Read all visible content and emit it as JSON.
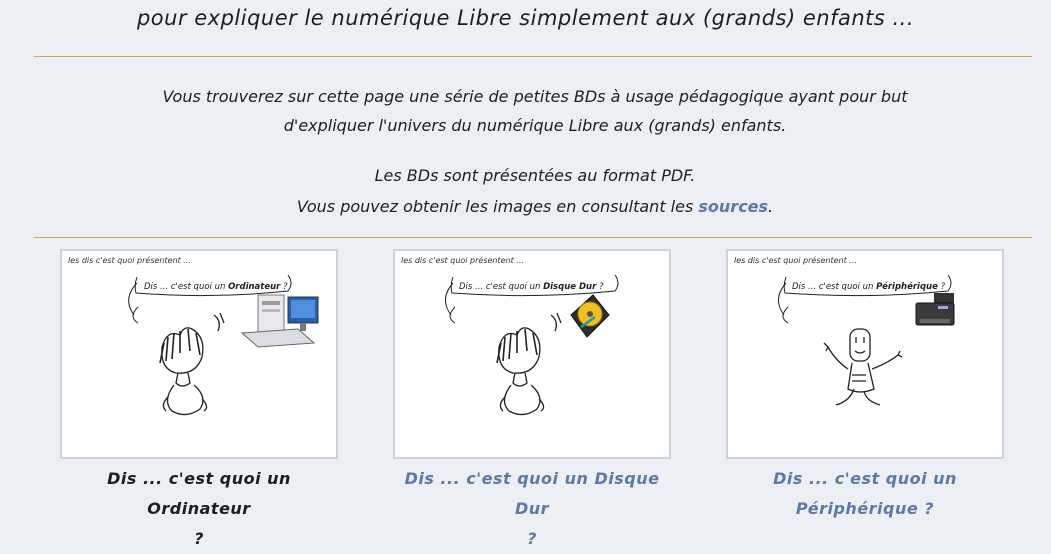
{
  "header": {
    "subtitle": "pour expliquer le numérique Libre simplement aux (grands) enfants ..."
  },
  "intro": {
    "line1": "Vous trouverez sur cette page une série de petites BDs à usage pédagogique ayant pour but",
    "line2": "d'expliquer l'univers du numérique Libre aux (grands) enfants.",
    "line3": "Les BDs sont présentées au format PDF.",
    "line4_before": "Vous pouvez obtenir les images en consultant les ",
    "line4_link": "sources",
    "line4_after": "."
  },
  "colors": {
    "background": "#ecf0f4",
    "separator": "#e2a64a",
    "link": "#5b7aa5"
  },
  "comics": [
    {
      "presenting": "les dis c'est quoi présentent ...",
      "bubble_prefix": "Dis ... c'est quoi un ",
      "bubble_object": "Ordinateur",
      "bubble_suffix": " ?",
      "caption_line1": "Dis ... c'est quoi un Ordinateur",
      "caption_line2": "?",
      "icon": "computer-icon"
    },
    {
      "presenting": "les dis c'est quoi présentent ...",
      "bubble_prefix": "Dis ... c'est quoi un ",
      "bubble_object": "Disque Dur",
      "bubble_suffix": " ?",
      "caption_line1": "Dis ... c'est quoi un Disque Dur",
      "caption_line2": "?",
      "icon": "hard-disk-icon"
    },
    {
      "presenting": "les dis c'est quoi présentent ...",
      "bubble_prefix": "Dis ... c'est quoi un ",
      "bubble_object": "Périphérique",
      "bubble_suffix": " ?",
      "caption_line1": "Dis ... c'est quoi un",
      "caption_line2": "Périphérique ?",
      "icon": "printer-icon"
    }
  ]
}
